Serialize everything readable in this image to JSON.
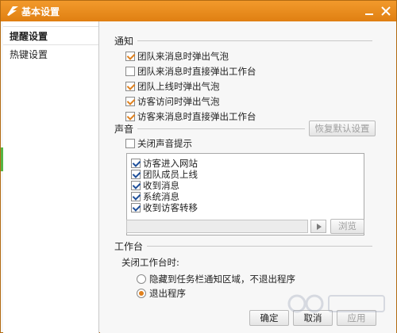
{
  "window": {
    "title": "基本设置"
  },
  "sidebar": {
    "items": [
      {
        "label": "提醒设置",
        "active": true
      },
      {
        "label": "热键设置",
        "active": false
      }
    ]
  },
  "notify": {
    "title": "通知",
    "options": [
      {
        "label": "团队来消息时弹出气泡",
        "checked": true
      },
      {
        "label": "团队来消息时直接弹出工作台",
        "checked": false
      },
      {
        "label": "团队上线时弹出气泡",
        "checked": true
      },
      {
        "label": "访客访问时弹出气泡",
        "checked": true
      },
      {
        "label": "访客来消息时直接弹出工作台",
        "checked": true
      }
    ]
  },
  "sound": {
    "title": "声音",
    "restore_label": "恢复默认设置",
    "mute_label": "关闭声音提示",
    "mute_checked": false,
    "events": [
      {
        "label": "访客进入网站",
        "checked": true
      },
      {
        "label": "团队成员上线",
        "checked": true
      },
      {
        "label": "收到消息",
        "checked": true
      },
      {
        "label": "系统消息",
        "checked": true
      },
      {
        "label": "收到访客转移",
        "checked": true
      }
    ],
    "browse_label": "浏览"
  },
  "workbench": {
    "title": "工作台",
    "close_label": "关闭工作台时:",
    "options": [
      {
        "label": "隐藏到任务栏通知区域，不退出程序",
        "checked": false
      },
      {
        "label": "退出程序",
        "checked": true
      }
    ]
  },
  "footer": {
    "ok_label": "确定",
    "cancel_label": "取消",
    "apply_label": "应用"
  },
  "colors": {
    "titlebar": "#e98a1c",
    "accent": "#e0801d"
  }
}
